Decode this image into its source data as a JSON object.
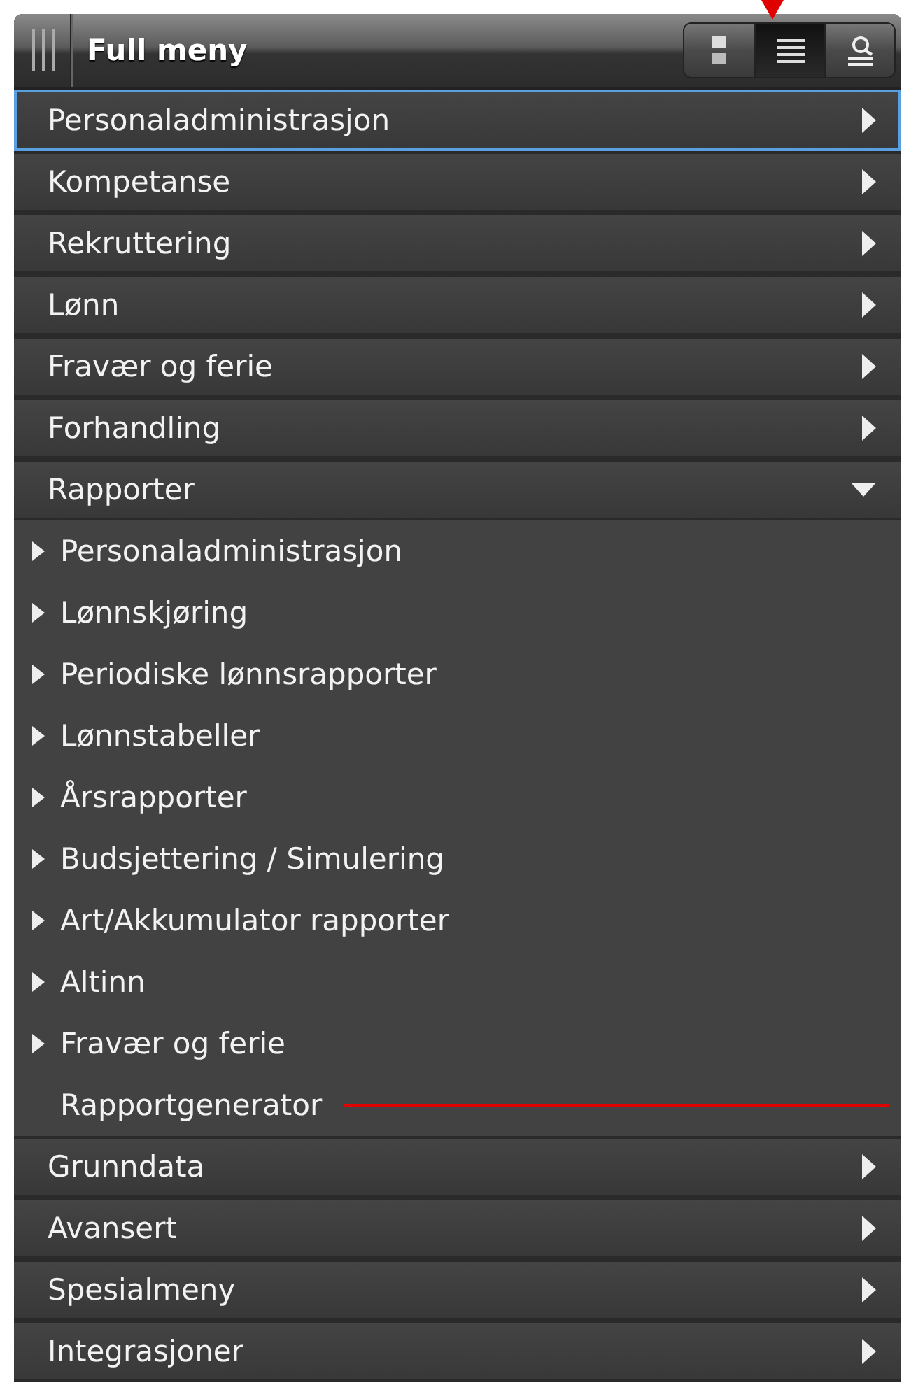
{
  "header": {
    "title": "Full meny",
    "view_buttons": [
      {
        "selected": false
      },
      {
        "selected": true
      },
      {
        "selected": false
      }
    ]
  },
  "menu": [
    {
      "label": "Personaladministrasjon",
      "expanded": false,
      "selected": true
    },
    {
      "label": "Kompetanse",
      "expanded": false,
      "selected": false
    },
    {
      "label": "Rekruttering",
      "expanded": false,
      "selected": false
    },
    {
      "label": "Lønn",
      "expanded": false,
      "selected": false
    },
    {
      "label": "Fravær og ferie",
      "expanded": false,
      "selected": false
    },
    {
      "label": "Forhandling",
      "expanded": false,
      "selected": false
    },
    {
      "label": "Rapporter",
      "expanded": true,
      "selected": false,
      "children": [
        {
          "label": "Personaladministrasjon",
          "has_children": true
        },
        {
          "label": "Lønnskjøring",
          "has_children": true
        },
        {
          "label": "Periodiske lønnsrapporter",
          "has_children": true
        },
        {
          "label": "Lønnstabeller",
          "has_children": true
        },
        {
          "label": "Årsrapporter",
          "has_children": true
        },
        {
          "label": "Budsjettering / Simulering",
          "has_children": true
        },
        {
          "label": "Art/Akkumulator rapporter",
          "has_children": true
        },
        {
          "label": "Altinn",
          "has_children": true
        },
        {
          "label": "Fravær og ferie",
          "has_children": true
        },
        {
          "label": "Rapportgenerator",
          "has_children": false
        }
      ]
    },
    {
      "label": "Grunndata",
      "expanded": false,
      "selected": false
    },
    {
      "label": "Avansert",
      "expanded": false,
      "selected": false
    },
    {
      "label": "Spesialmeny",
      "expanded": false,
      "selected": false
    },
    {
      "label": "Integrasjoner",
      "expanded": false,
      "selected": false
    }
  ]
}
